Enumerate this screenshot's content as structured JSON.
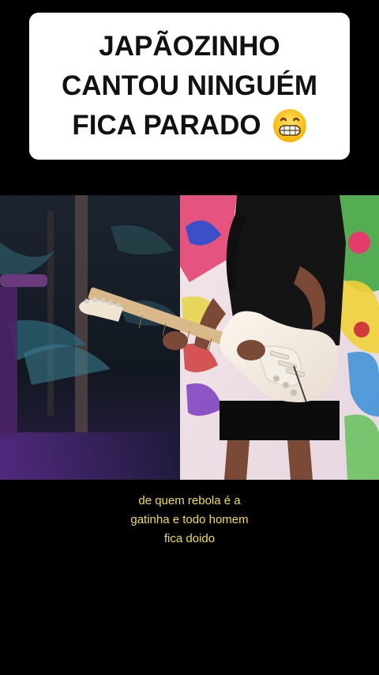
{
  "title": {
    "lines": [
      "JAPÃOZINHO",
      "CANTOU NINGUÉM",
      "FICA PARADO"
    ],
    "emoji": "grinning-face-with-big-teeth"
  },
  "video": {
    "scene": "guitarist-playing-electric-guitar"
  },
  "captions": {
    "lines": [
      "de quem rebola é a",
      "gatinha e todo homem",
      "fica doido"
    ]
  },
  "colors": {
    "background": "#000000",
    "title_card": "#ffffff",
    "title_text": "#111111",
    "caption_text": "#f2dc52"
  }
}
